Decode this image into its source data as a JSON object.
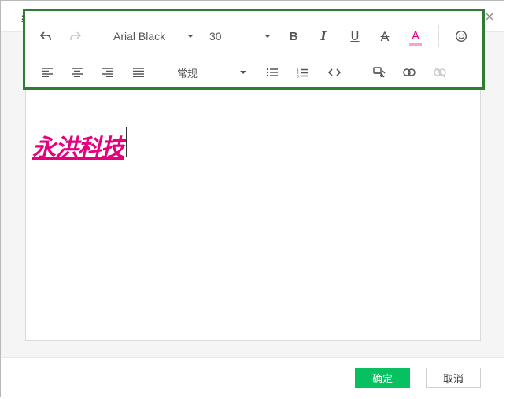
{
  "dialog": {
    "title": "编辑",
    "close_icon": "close-icon"
  },
  "toolbar": {
    "undo_icon": "undo-icon",
    "redo_icon": "redo-icon",
    "font_family": "Arial Black",
    "font_size": "30",
    "bold_label": "B",
    "italic_label": "I",
    "underline_label": "U",
    "strike_label": "A",
    "font_color_label": "A",
    "font_color": "#f4a6c7",
    "emoji_icon": "emoji-icon",
    "align_left_icon": "align-left-icon",
    "align_center_icon": "align-center-icon",
    "align_right_icon": "align-right-icon",
    "align_justify_icon": "align-justify-icon",
    "paragraph_format": "常规",
    "bullet_list_icon": "bullet-list-icon",
    "numbered_list_icon": "numbered-list-icon",
    "code_icon": "code-icon",
    "image_icon": "image-icon",
    "link_icon": "link-icon",
    "unlink_icon": "unlink-icon",
    "highlight_border_color": "#2e7d32"
  },
  "editor": {
    "content_text": "永洪科技",
    "content_color": "#e6007e"
  },
  "footer": {
    "ok_label": "确定",
    "cancel_label": "取消",
    "ok_color": "#07c160"
  }
}
